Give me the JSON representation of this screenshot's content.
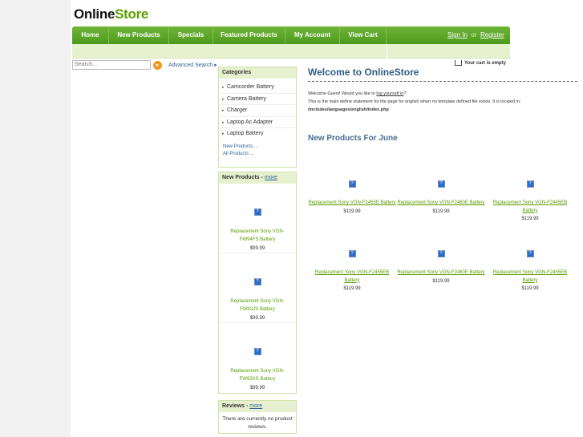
{
  "logo": {
    "part1": "Online",
    "part2": "Store"
  },
  "nav": {
    "items": [
      "Home",
      "New Products",
      "Specials",
      "Featured Products",
      "My Account",
      "View Cart"
    ],
    "sign_in": "Sign In",
    "or": "or",
    "register": "Register"
  },
  "search": {
    "placeholder": "Search...",
    "advanced": "Advanced Search ▸"
  },
  "cart": {
    "text": "Your cart is empty"
  },
  "categories": {
    "title": "Categories",
    "items": [
      "Camcorder Battery",
      "Camera Battery",
      "Charger",
      "Laptop Ac Adapter",
      "Laptop Battery"
    ],
    "new_products_link": "New Products ...",
    "all_products_link": "All Products ..."
  },
  "sidebar_new": {
    "title": "New Products - ",
    "more": "more",
    "items": [
      {
        "name": "Replacement Sony VGN-FW94FS Battery",
        "price": "$99.99"
      },
      {
        "name": "Replacement Sony VGN-FW93JS Battery",
        "price": "$99.99"
      },
      {
        "name": "Replacement Sony VGN-FW93XS Battery",
        "price": "$99.99"
      }
    ]
  },
  "reviews": {
    "title": "Reviews - ",
    "more": "more",
    "body": "There are currently no product reviews."
  },
  "main": {
    "title": "Welcome to OnlineStore",
    "greeting_pre": "Welcome Guest! Would you like to ",
    "greeting_link": "log yourself in",
    "greeting_post": "?",
    "define_text": "This is the main define statement for the page for english when no template defined file exists. It is located in:",
    "define_path": "/includes/languages/english/index.php",
    "new_heading": "New Products For June",
    "products": [
      {
        "name": "Replacement Sony VGN-F2455E Battery",
        "price": "$119.99"
      },
      {
        "name": "Replacement Sony VGN-F2460E Battery",
        "price": "$119.99"
      },
      {
        "name": "Replacement Sony VGN-F2445EB Battery",
        "price": "$119.99"
      },
      {
        "name": "Replacement Sony VGN-F2455EB Battery",
        "price": "$119.99"
      },
      {
        "name": "Replacement Sony VGN-F2460E Battery",
        "price": "$119.99"
      },
      {
        "name": "Replacement Sony VGN-F2455EB Battery",
        "price": "$119.99"
      }
    ],
    "image_placeholder": "?"
  },
  "colors": {
    "nav_green": "#5aa52a",
    "link_green": "#5a9a00",
    "heading_blue": "#2e5c85"
  }
}
